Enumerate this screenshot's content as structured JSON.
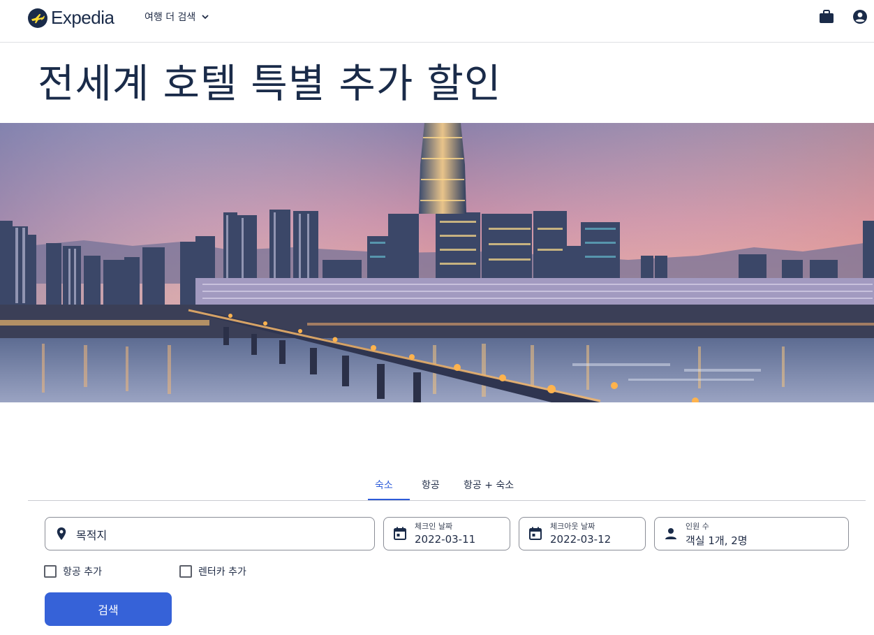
{
  "header": {
    "brand": "Expedia",
    "more_travel_label": "여행 더 검색",
    "icons": {
      "logo": "expedia-plane-logo",
      "trips": "briefcase-icon",
      "account": "account-icon",
      "dropdown": "chevron-down-icon"
    }
  },
  "page_title": "전세계 호텔 특별 추가 할인",
  "tabs": [
    {
      "label": "숙소",
      "active": true
    },
    {
      "label": "항공",
      "active": false
    },
    {
      "label": "항공 + 숙소",
      "active": false
    }
  ],
  "search": {
    "destination": {
      "placeholder": "목적지",
      "icon": "location-pin-icon"
    },
    "check_in": {
      "label": "체크인 날짜",
      "value": "2022-03-11",
      "icon": "calendar-icon"
    },
    "check_out": {
      "label": "체크아웃 날짜",
      "value": "2022-03-12",
      "icon": "calendar-icon"
    },
    "travelers": {
      "label": "인원 수",
      "value": "객실 1개, 2명",
      "icon": "person-icon"
    },
    "add_flight": {
      "label": "항공 추가",
      "checked": false
    },
    "add_car": {
      "label": "렌터카 추가",
      "checked": false
    },
    "submit_label": "검색"
  },
  "colors": {
    "brand_navy": "#1a2b49",
    "accent_blue": "#3662d8",
    "logo_yellow": "#fddb32",
    "divider": "#dfe0e4"
  }
}
